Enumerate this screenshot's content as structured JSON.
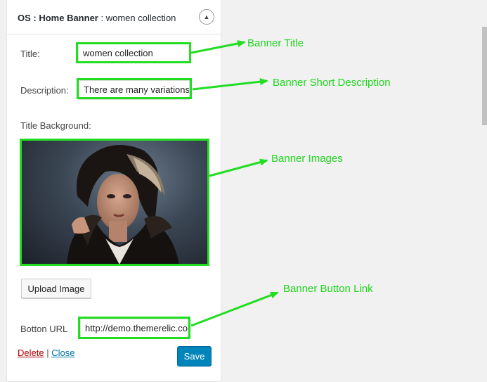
{
  "widget": {
    "title_bold": "OS : Home Banner",
    "title_sub": " : women collection",
    "toggle_icon": "▲"
  },
  "form": {
    "title_label": "Title:",
    "title_value": "women collection",
    "description_label": "Description:",
    "description_value": "There are many variations",
    "background_label": "Title Background:",
    "upload_label": "Upload Image",
    "button_url_label": "Botton URL",
    "button_url_value": "http://demo.themerelic.com"
  },
  "footer": {
    "delete_label": "Delete",
    "separator": " | ",
    "close_label": "Close",
    "save_label": "Save"
  },
  "annotations": {
    "banner_title": "Banner Title",
    "banner_description": "Banner Short Description",
    "banner_images": "Banner Images",
    "banner_button_link": "Banner Button Link"
  },
  "colors": {
    "highlight": "#22dd22",
    "save_button": "#0085ba",
    "delete_link": "#aa0000",
    "close_link": "#0073aa"
  }
}
